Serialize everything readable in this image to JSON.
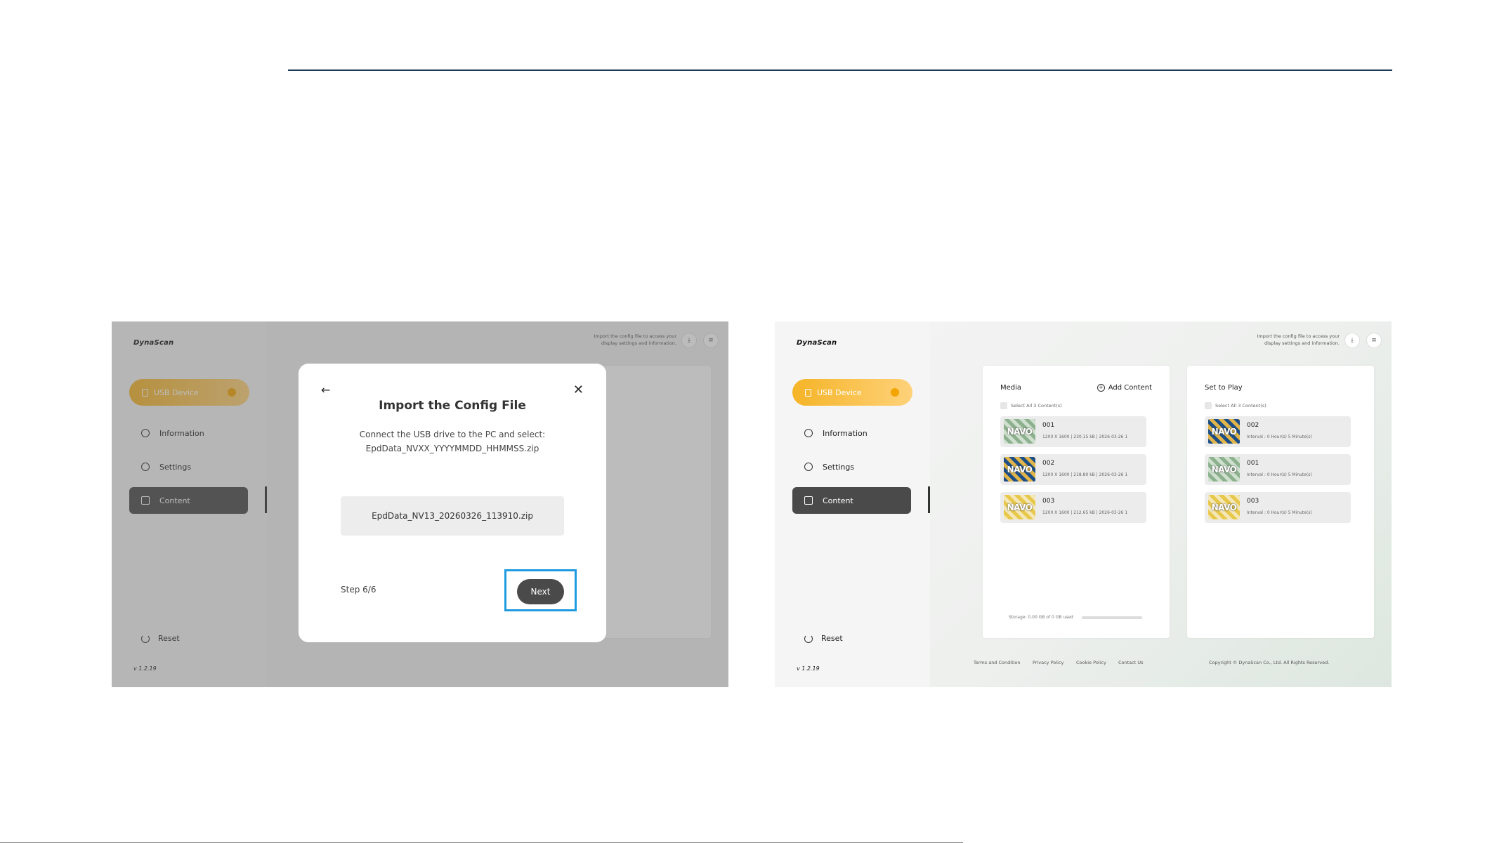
{
  "app": {
    "logo": "DynaScan",
    "version": "v 1.2.19",
    "usb_device": "USB Device",
    "nav": {
      "information": "Information",
      "settings": "Settings",
      "content": "Content",
      "reset": "Reset"
    },
    "header_info": "Import the config file to access your display settings and information."
  },
  "media": {
    "title": "Media",
    "add_content": "Add Content",
    "select_all": "Select All 3 Content(s)",
    "items": [
      {
        "name": "001",
        "meta": "1200 X 1600 | 230.15 kB | 2026-03-26 1",
        "thumb_text": "NAVO"
      },
      {
        "name": "002",
        "meta": "1200 X 1600 | 218.80 kB | 2026-03-26 1",
        "thumb_text": "NAVO"
      },
      {
        "name": "003",
        "meta": "1200 X 1600 | 212.65 kB | 2026-03-26 1",
        "thumb_text": "NAVO"
      }
    ],
    "storage": "Storage: 0.00 GB of 0 GB used"
  },
  "set_to_play": {
    "title": "Set to Play",
    "select_all": "Select All 3 Content(s)",
    "items": [
      {
        "name": "002",
        "meta": "Interval : 0 Hour(s) 5 Minute(s)",
        "thumb_text": "NAVO"
      },
      {
        "name": "001",
        "meta": "Interval : 0 Hour(s) 5 Minute(s)",
        "thumb_text": "NAVO"
      },
      {
        "name": "003",
        "meta": "Interval : 0 Hour(s) 5 Minute(s)",
        "thumb_text": "NAVO"
      }
    ]
  },
  "footer": {
    "terms": "Terms and Condition",
    "privacy": "Privacy Policy",
    "cookie": "Cookie Policy",
    "contact": "Contact Us",
    "copyright": "Copyright © DynaScan Co., Ltd. All Rights Reserved."
  },
  "dialog": {
    "title": "Import the Config File",
    "description_line1": "Connect the USB drive to the PC and select:",
    "description_line2": "EpdData_NVXX_YYYYMMDD_HHMMSS.zip",
    "file_name": "EpdData_NV13_20260326_113910.zip",
    "step": "Step 6/6",
    "next": "Next"
  },
  "colors": {
    "accent": "#f5b427",
    "highlight": "#1e9be0",
    "dark": "#4a4a4a",
    "rule": "#1f3b57"
  }
}
